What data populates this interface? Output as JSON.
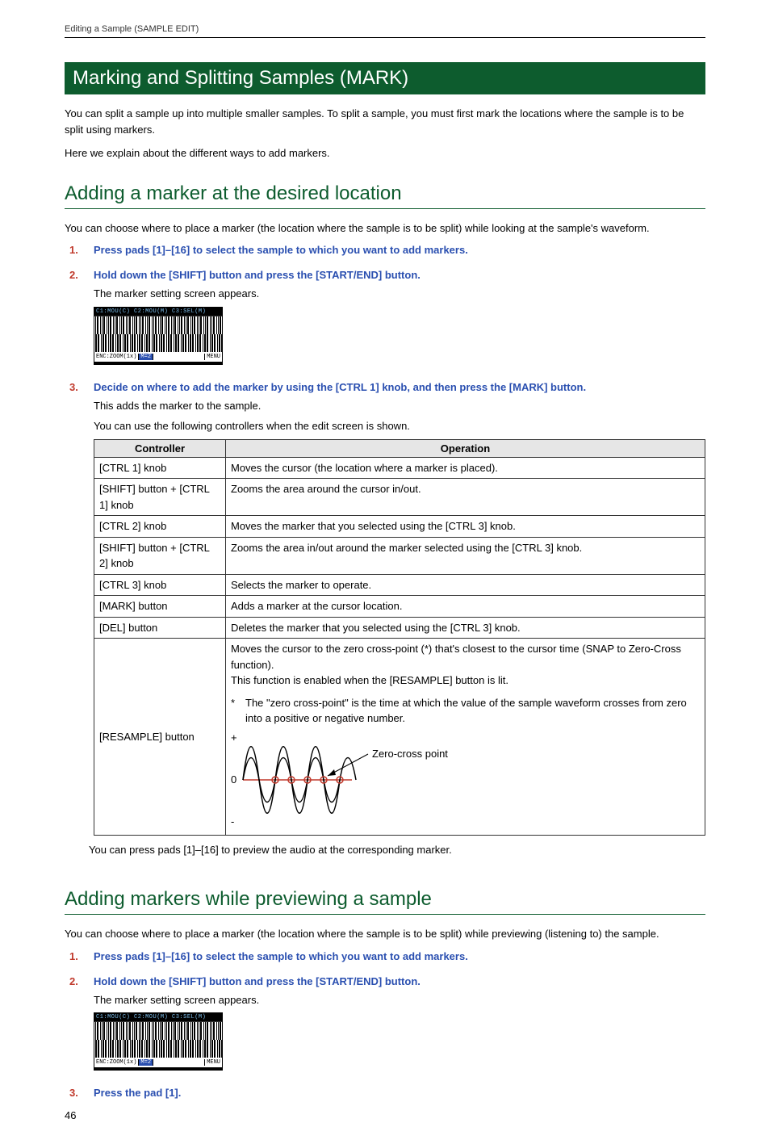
{
  "running_header": "Editing a Sample (SAMPLE EDIT)",
  "section_title": "Marking and Splitting Samples (MARK)",
  "intro_p1": "You can split a sample up into multiple smaller samples. To split a sample, you must first mark the locations where the sample is to be split using markers.",
  "intro_p2": "Here we explain about the different ways to add markers.",
  "sub1_title": "Adding a marker at the desired location",
  "sub1_intro": "You can choose where to place a marker (the location where the sample is to be split) while looking at the sample's waveform.",
  "sub1_steps": {
    "s1_num": "1.",
    "s1_title": "Press pads [1]–[16] to select the sample to which you want to add markers.",
    "s2_num": "2.",
    "s2_title": "Hold down the [SHIFT] button and press the [START/END] button.",
    "s2_desc": "The marker setting screen appears.",
    "s3_num": "3.",
    "s3_title": "Decide on where to add the marker by using the [CTRL 1] knob, and then press the [MARK] button.",
    "s3_desc1": "This adds the marker to the sample.",
    "s3_desc2": "You can use the following controllers when the edit screen is shown."
  },
  "screenshot": {
    "top": "C1:MOU(C)  C2:MOU(M)  C3:SEL(M)",
    "zoom": "ENC:ZOOM(1x)",
    "mark": "M=2",
    "menu": "MENU"
  },
  "table": {
    "h_controller": "Controller",
    "h_operation": "Operation",
    "rows": {
      "r0_c": "[CTRL 1] knob",
      "r0_o": "Moves the cursor (the location where a marker is placed).",
      "r1_c": "[SHIFT] button + [CTRL 1] knob",
      "r1_o": "Zooms the area around the cursor in/out.",
      "r2_c": "[CTRL 2] knob",
      "r2_o": "Moves the marker that you selected using the [CTRL 3] knob.",
      "r3_c": "[SHIFT] button + [CTRL 2] knob",
      "r3_o": "Zooms the area in/out around the marker selected using the [CTRL 3] knob.",
      "r4_c": "[CTRL 3] knob",
      "r4_o": "Selects the marker to operate.",
      "r5_c": "[MARK] button",
      "r5_o": "Adds a marker at the cursor location.",
      "r6_c": "[DEL] button",
      "r6_o": "Deletes the marker that you selected using the [CTRL 3] knob.",
      "r7_c": "[RESAMPLE] button",
      "r7_o1": "Moves the cursor to the zero cross-point (*) that's closest to the cursor time (SNAP to Zero-Cross function).",
      "r7_o2": "This function is enabled when the [RESAMPLE] button is lit.",
      "r7_star": "*",
      "r7_o3": "The \"zero cross-point\" is the time at which the value of the sample waveform crosses from zero into a positive or negative number.",
      "r7_plus": "+",
      "r7_zero": "0",
      "r7_minus": "-",
      "r7_label": "Zero-cross point"
    }
  },
  "table_note": "You can press pads [1]–[16] to preview the audio at the corresponding marker.",
  "sub2_title": "Adding markers while previewing a sample",
  "sub2_intro": "You can choose where to place a marker (the location where the sample is to be split) while previewing (listening to) the sample.",
  "sub2_steps": {
    "s1_num": "1.",
    "s1_title": "Press pads [1]–[16] to select the sample to which you want to add markers.",
    "s2_num": "2.",
    "s2_title": "Hold down the [SHIFT] button and press the [START/END] button.",
    "s2_desc": "The marker setting screen appears.",
    "s3_num": "3.",
    "s3_title": "Press the pad [1]."
  },
  "page_number": "46"
}
